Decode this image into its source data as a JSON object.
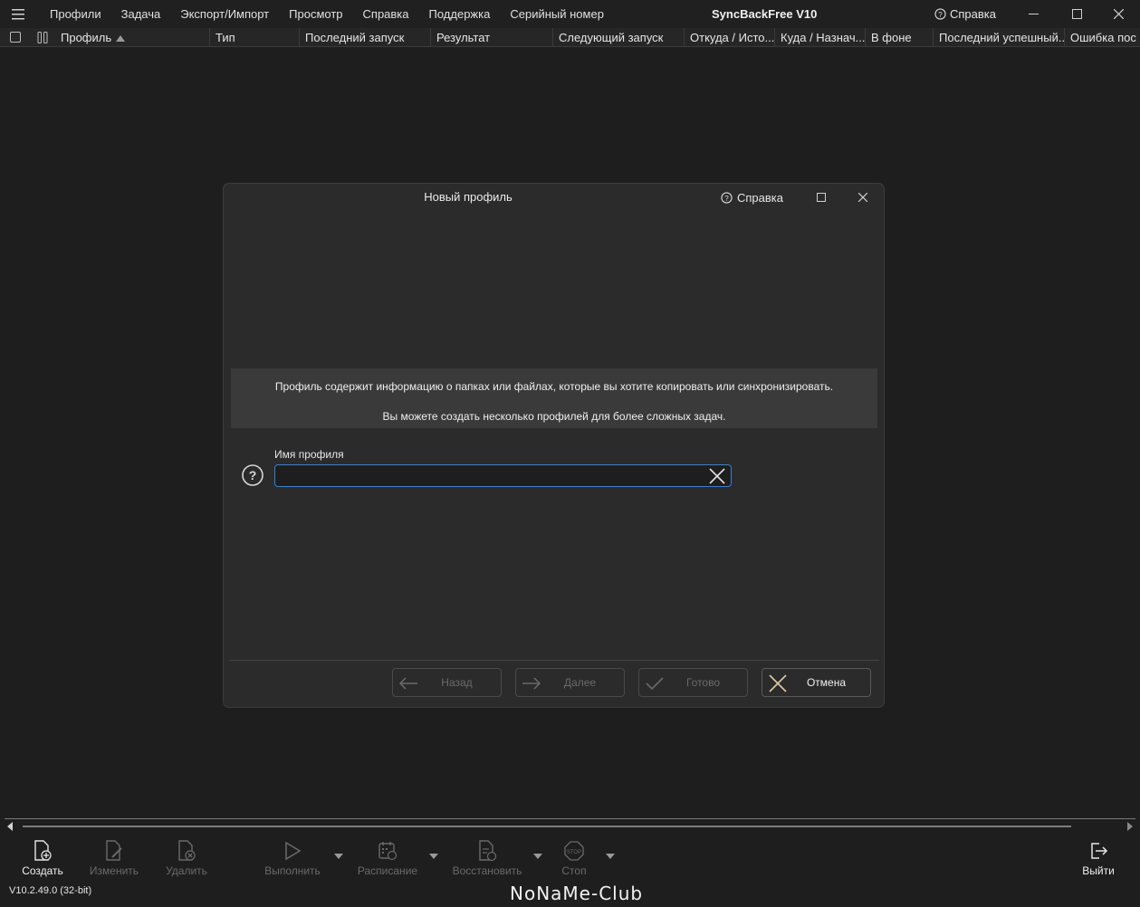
{
  "menu": {
    "items": [
      "Профили",
      "Задача",
      "Экспорт/Импорт",
      "Просмотр",
      "Справка",
      "Поддержка",
      "Серийный номер"
    ]
  },
  "app": {
    "title": "SyncBackFree V10",
    "help_label": "Справка"
  },
  "columns": {
    "headers": [
      "Профиль",
      "Тип",
      "Последний запуск",
      "Результат",
      "Следующий запуск",
      "Откуда / Исто...",
      "Куда / Назнач...",
      "В фоне",
      "Последний успешный...",
      "Ошибка пос"
    ],
    "sorted_column": "Профиль",
    "sort_direction": "ascending"
  },
  "dialog": {
    "title": "Новый профиль",
    "help_label": "Справка",
    "info_line1": "Профиль содержит информацию о папках или файлах, которые вы хотите копировать или синхронизировать.",
    "info_line2": "Вы можете создать несколько профилей для более сложных задач.",
    "field_label": "Имя профиля",
    "field_value": "",
    "buttons": {
      "back": "Назад",
      "next": "Далее",
      "finish": "Готово",
      "cancel": "Отмена"
    }
  },
  "toolbar": {
    "create": "Создать",
    "edit": "Изменить",
    "delete": "Удалить",
    "run": "Выполнить",
    "schedule": "Расписание",
    "restore": "Восстановить",
    "stop": "Стоп",
    "exit": "Выйти"
  },
  "status": {
    "version": "V10.2.49.0 (32-bit)",
    "watermark": "NoNaMe-Club"
  },
  "colors": {
    "background": "#1e1e1e",
    "dialog": "#2b2b2b",
    "input_focus": "#3f7fc6",
    "cancel_icon": "#d8c9a0"
  }
}
